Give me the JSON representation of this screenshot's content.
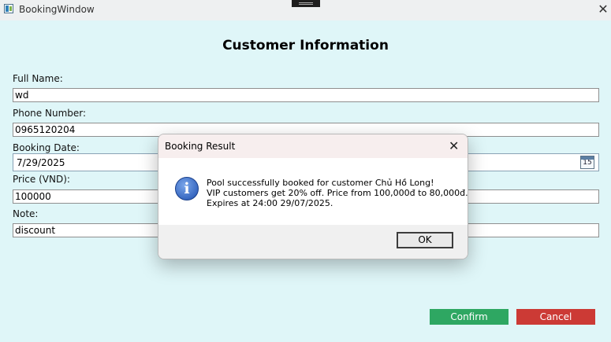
{
  "window": {
    "title": "BookingWindow",
    "close_glyph": "✕"
  },
  "form": {
    "heading": "Customer Information",
    "full_name": {
      "label": "Full Name:",
      "value": "wd"
    },
    "phone": {
      "label": "Phone Number:",
      "value": "0965120204"
    },
    "booking_date": {
      "label": "Booking Date:",
      "value": "7/29/2025",
      "calendar_day": "15"
    },
    "price": {
      "label": "Price (VND):",
      "value": "100000"
    },
    "note": {
      "label": "Note:",
      "value": "discount"
    },
    "confirm_label": "Confirm",
    "cancel_label": "Cancel"
  },
  "dialog": {
    "title": "Booking Result",
    "close_glyph": "✕",
    "icon": "info-icon",
    "icon_glyph": "i",
    "lines": [
      "Pool successfully booked for customer Chủ Hồ Long!",
      "VIP customers get 20% off. Price from 100,000đ to 80,000đ.",
      "Expires at 24:00 29/07/2025."
    ],
    "ok_label": "OK"
  },
  "colors": {
    "background": "#dff6f8",
    "confirm": "#2ea762",
    "cancel": "#cc3a35"
  }
}
